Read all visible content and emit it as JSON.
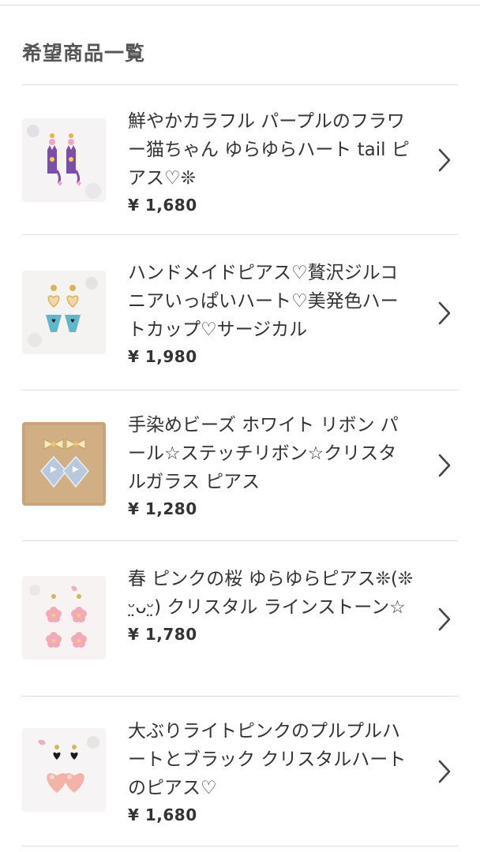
{
  "section": {
    "title": "希望商品一覧"
  },
  "items": [
    {
      "name": "鮮やかカラフル パープルのフラワー猫ちゃん ゆらゆらハート tail ピアス♡❊",
      "price": "¥ 1,680",
      "thumb_accent": "#7b4fa8"
    },
    {
      "name": "ハンドメイドピアス♡贅沢ジルコニアいっぱいハート♡美発色ハートカップ♡サージカル",
      "price": "¥ 1,980",
      "thumb_accent": "#5fb7c9"
    },
    {
      "name": "手染めビーズ ホワイト リボン パール☆ステッチリボン☆クリスタルガラス ピアス",
      "price": "¥ 1,280",
      "thumb_accent": "#b9c9dd"
    },
    {
      "name": "春 ピンクの桜 ゆらゆらピアス❊(❊ᵕ̤ᴗᵕ̤) クリスタル ラインストーン☆",
      "price": "¥ 1,780",
      "thumb_accent": "#f2a9b8"
    },
    {
      "name": "大ぶりライトピンクのプルプルハートとブラック クリスタルハートのピアス♡",
      "price": "¥ 1,680",
      "thumb_accent": "#f4b3a9"
    }
  ],
  "colors": {
    "divider": "#dcdcdc",
    "text": "#333333",
    "title": "#555555",
    "chevron": "#444444"
  }
}
